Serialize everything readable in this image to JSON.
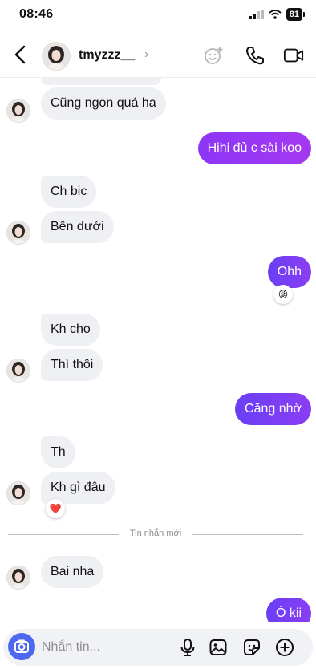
{
  "status_bar": {
    "time": "08:46",
    "battery": "81"
  },
  "header": {
    "username": "tmyzzz__",
    "chevron": "›"
  },
  "messages": {
    "m1": "Cũng ngon quá ha",
    "m2": "Hihi đủ c sài koo",
    "m3": "Ch bic",
    "m4": "Bên dưới",
    "m5": "Ohh",
    "m5_reaction": "😡",
    "m6": "Kh cho",
    "m7": "Thì thôi",
    "m8": "Căng nhờ",
    "m9": "Th",
    "m10": "Kh gì đâu",
    "m10_reaction": "❤️",
    "m11": "Bai nha",
    "m12": "Ó kii"
  },
  "divider": {
    "label": "Tin nhắn mới"
  },
  "composer": {
    "placeholder": "Nhắn tin..."
  },
  "colors": {
    "accent": "#9b37f4",
    "camera": "#4e68ef",
    "incoming_bg": "#eff0f3"
  }
}
